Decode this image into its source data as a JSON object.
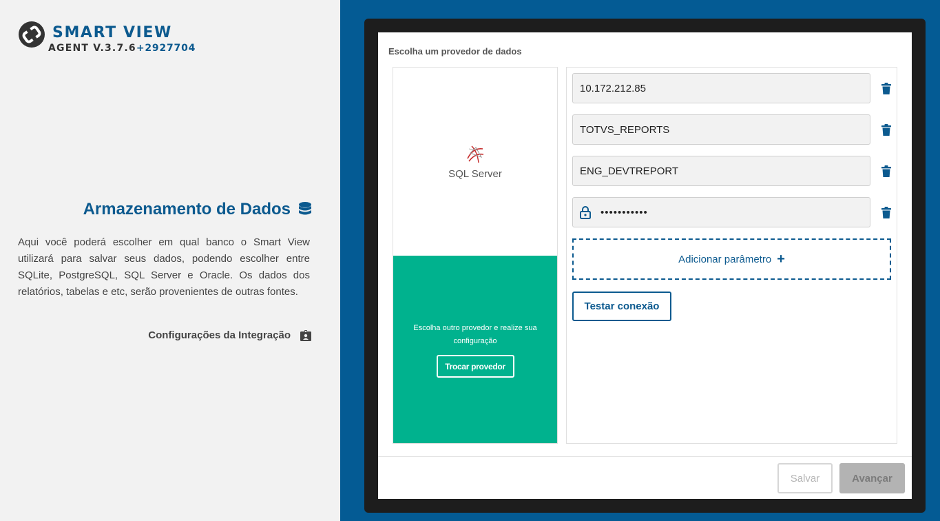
{
  "brand": {
    "name": "SMART VIEW",
    "agent_label": "AGENT V.3.7.6",
    "build": "+2927704",
    "logo_icon": "totvs-logo-icon"
  },
  "storage": {
    "title": "Armazenamento de Dados",
    "title_icon": "database-icon",
    "description": "Aqui você poderá escolher em qual banco o Smart View utilizará para salvar seus dados, podendo escolher entre SQLite, PostgreSQL, SQL Server e Oracle. Os dados dos relatórios, tabelas e etc, serão provenientes de outras fontes.",
    "integration_link": "Configurações da Integração",
    "integration_icon": "id-badge-icon"
  },
  "card": {
    "label": "Escolha um provedor de dados",
    "provider": {
      "name": "SQL Server",
      "icon": "sql-server-icon",
      "hint": "Escolha outro provedor e realize sua configuração",
      "swap_button": "Trocar provedor"
    },
    "params": [
      {
        "value": "10.172.212.85",
        "secret": false
      },
      {
        "value": "TOTVS_REPORTS",
        "secret": false
      },
      {
        "value": "ENG_DEVTREPORT",
        "secret": false
      },
      {
        "value": "•••••••••••",
        "secret": true,
        "icon": "lock-icon"
      }
    ],
    "add_param": "Adicionar parâmetro",
    "test_button": "Testar conexão",
    "save_button": "Salvar",
    "next_button": "Avançar"
  },
  "colors": {
    "brand_blue": "#0c5a8f",
    "panel_blue": "#045b94",
    "provider_green": "#00b28e"
  }
}
